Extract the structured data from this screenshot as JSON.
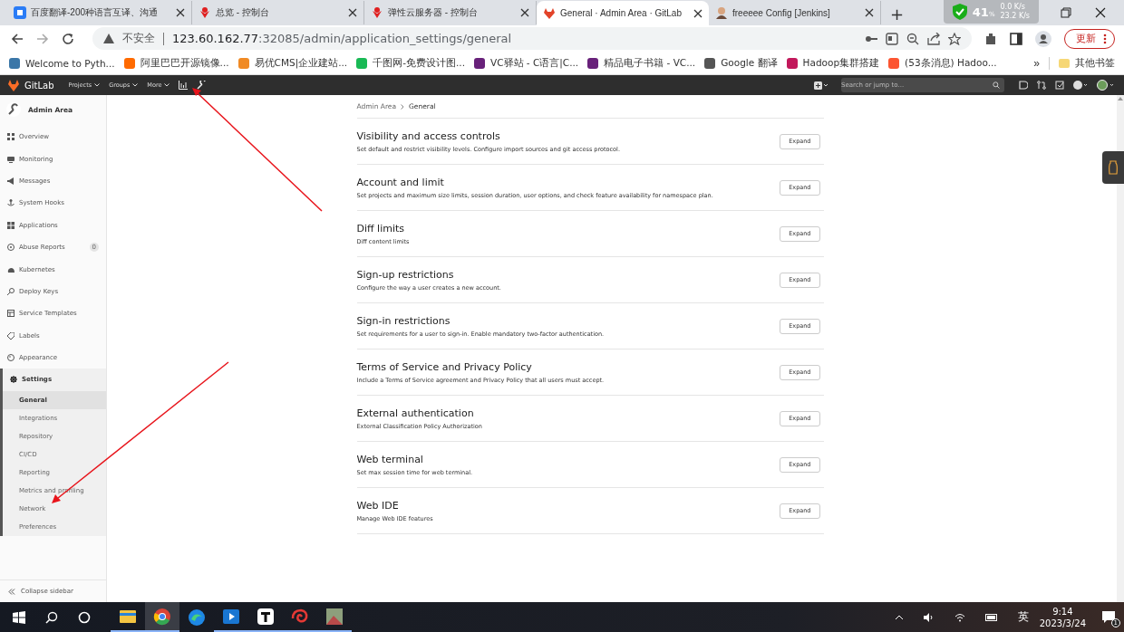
{
  "browser": {
    "tabs": [
      {
        "title": "百度翻译-200种语言互译、沟通",
        "selected": false
      },
      {
        "title": "总览 - 控制台",
        "selected": false
      },
      {
        "title": "弹性云服务器 - 控制台",
        "selected": false
      },
      {
        "title": "General · Admin Area · GitLab",
        "selected": true
      },
      {
        "title": "freeeee Config [Jenkins]",
        "selected": false
      }
    ],
    "new_tab": "+",
    "net_monitor": {
      "percent": "41",
      "unit": "%",
      "upload": "0.0 K/s",
      "download": "23.2 K/s"
    },
    "address": {
      "security": "不安全",
      "host": "123.60.162.77",
      "rest": ":32085/admin/application_settings/general"
    },
    "update_button": "更新",
    "bookmarks": [
      {
        "label": "Welcome to Pyth..."
      },
      {
        "label": "阿里巴巴开源镜像..."
      },
      {
        "label": "易优CMS|企业建站..."
      },
      {
        "label": "千图网-免费设计图..."
      },
      {
        "label": "VC驿站 - C语言|C..."
      },
      {
        "label": "精品电子书籍 - VC..."
      },
      {
        "label": "Google 翻译"
      },
      {
        "label": "Hadoop集群搭建"
      },
      {
        "label": "(53条消息) Hadoo..."
      }
    ],
    "bookmark_overflow": "»",
    "other_bookmarks": "其他书签"
  },
  "gitlab": {
    "brand": "GitLab",
    "nav": [
      "Projects",
      "Groups",
      "More"
    ],
    "search": {
      "placeholder": "Search or jump to..."
    }
  },
  "sidebar": {
    "title": "Admin Area",
    "items": [
      {
        "label": "Overview",
        "selected": false
      },
      {
        "label": "Monitoring",
        "selected": false
      },
      {
        "label": "Messages",
        "selected": false
      },
      {
        "label": "System Hooks",
        "selected": false
      },
      {
        "label": "Applications",
        "selected": false
      },
      {
        "label": "Abuse Reports",
        "selected": false,
        "badge": "0"
      },
      {
        "label": "Kubernetes",
        "selected": false
      },
      {
        "label": "Deploy Keys",
        "selected": false
      },
      {
        "label": "Service Templates",
        "selected": false
      },
      {
        "label": "Labels",
        "selected": false
      },
      {
        "label": "Appearance",
        "selected": false
      },
      {
        "label": "Settings",
        "selected": true,
        "expanded": true,
        "children": [
          {
            "label": "General",
            "selected": true
          },
          {
            "label": "Integrations",
            "selected": false
          },
          {
            "label": "Repository",
            "selected": false
          },
          {
            "label": "CI/CD",
            "selected": false
          },
          {
            "label": "Reporting",
            "selected": false
          },
          {
            "label": "Metrics and profiling",
            "selected": false
          },
          {
            "label": "Network",
            "selected": false
          },
          {
            "label": "Preferences",
            "selected": false
          }
        ]
      }
    ],
    "collapse": "Collapse sidebar"
  },
  "breadcrumb": [
    "Admin Area",
    "General"
  ],
  "sections": [
    {
      "title": "Visibility and access controls",
      "description": "Set default and restrict visibility levels. Configure import sources and git access protocol.",
      "button": "Expand"
    },
    {
      "title": "Account and limit",
      "description": "Set projects and maximum size limits, session duration, user options, and check feature availability for namespace plan.",
      "button": "Expand"
    },
    {
      "title": "Diff limits",
      "description": "Diff content limits",
      "button": "Expand"
    },
    {
      "title": "Sign-up restrictions",
      "description": "Configure the way a user creates a new account.",
      "button": "Expand"
    },
    {
      "title": "Sign-in restrictions",
      "description": "Set requirements for a user to sign-in. Enable mandatory two-factor authentication.",
      "button": "Expand"
    },
    {
      "title": "Terms of Service and Privacy Policy",
      "description": "Include a Terms of Service agreement and Privacy Policy that all users must accept.",
      "button": "Expand"
    },
    {
      "title": "External authentication",
      "description": "External Classification Policy Authorization",
      "button": "Expand"
    },
    {
      "title": "Web terminal",
      "description": "Set max session time for web terminal.",
      "button": "Expand"
    },
    {
      "title": "Web IDE",
      "description": "Manage Web IDE features",
      "button": "Expand"
    }
  ],
  "taskbar": {
    "apps": [
      {
        "running": true,
        "selected": false
      },
      {
        "running": true,
        "selected": true
      },
      {
        "running": false,
        "selected": false
      },
      {
        "running": true,
        "selected": false
      },
      {
        "running": true,
        "selected": false
      },
      {
        "running": true,
        "selected": false
      },
      {
        "running": true,
        "selected": false
      }
    ],
    "ime": "英",
    "time": "9:14",
    "date": "2023/3/24",
    "notifications": "1"
  }
}
